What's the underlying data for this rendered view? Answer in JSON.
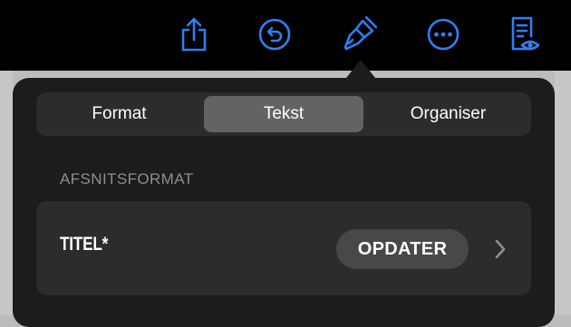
{
  "toolbar": {
    "icons": [
      "share-icon",
      "undo-icon",
      "format-brush-icon",
      "more-icon",
      "reader-view-icon"
    ],
    "accent_color": "#2f7ff6"
  },
  "format_popover": {
    "tabs": [
      {
        "label": "Format",
        "selected": false
      },
      {
        "label": "Tekst",
        "selected": true
      },
      {
        "label": "Organiser",
        "selected": false
      }
    ],
    "section_header": "AFSNITSFORMAT",
    "paragraph_style": {
      "name": "TITEL*",
      "update_label": "OPDATER",
      "chevron_icon": "chevron-right-icon"
    }
  }
}
